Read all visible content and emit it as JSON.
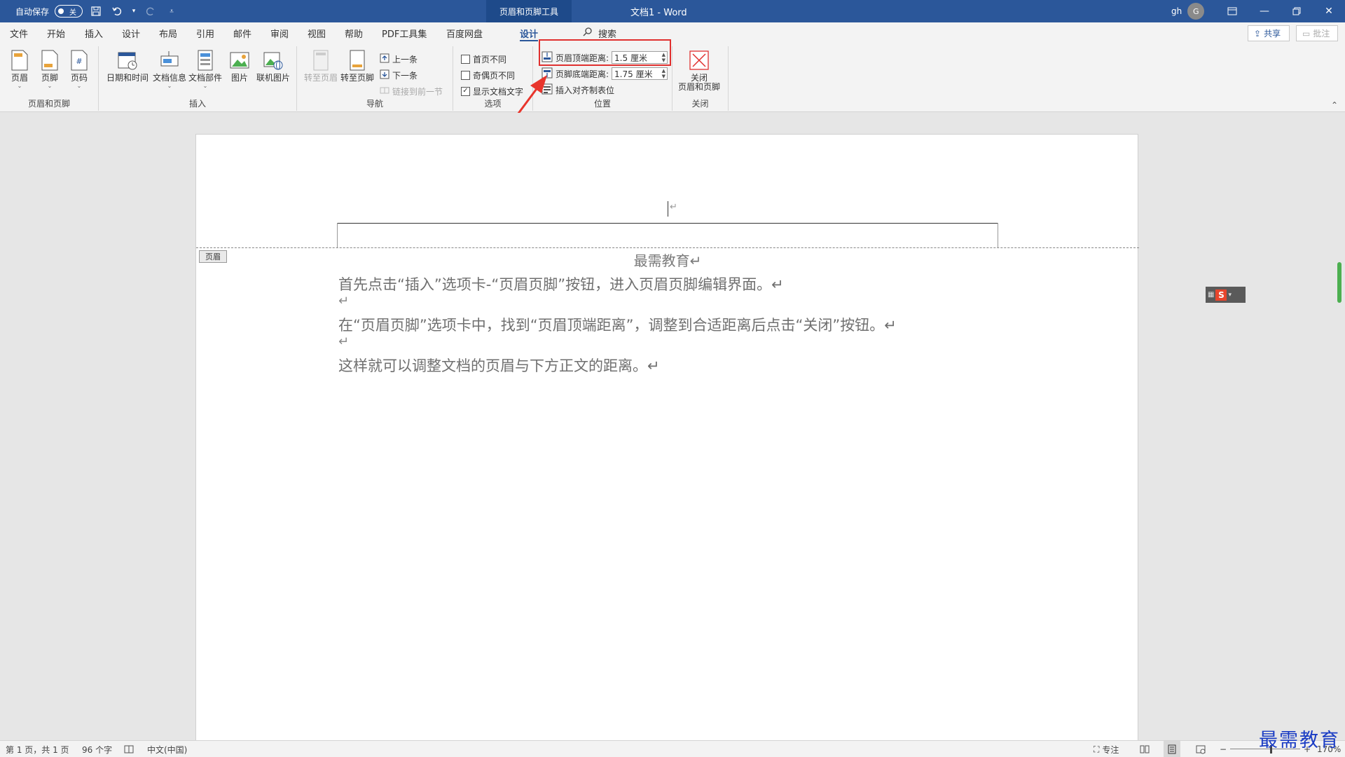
{
  "titlebar": {
    "autosave_label": "自动保存",
    "autosave_state": "关",
    "context_tab_title": "页眉和页脚工具",
    "doc_title": "文档1 - Word",
    "user_initials": "gh",
    "avatar_letter": "G",
    "accent_color": "#2b579a"
  },
  "tabs": [
    {
      "label": "文件",
      "active": false
    },
    {
      "label": "开始",
      "active": false
    },
    {
      "label": "插入",
      "active": false
    },
    {
      "label": "设计",
      "active": false
    },
    {
      "label": "布局",
      "active": false
    },
    {
      "label": "引用",
      "active": false
    },
    {
      "label": "邮件",
      "active": false
    },
    {
      "label": "审阅",
      "active": false
    },
    {
      "label": "视图",
      "active": false
    },
    {
      "label": "帮助",
      "active": false
    },
    {
      "label": "PDF工具集",
      "active": false
    },
    {
      "label": "百度网盘",
      "active": false
    },
    {
      "label": "设计",
      "active": true
    }
  ],
  "search_label": "搜索",
  "share_label": "共享",
  "comment_label": "批注",
  "ribbon": {
    "groups": {
      "header_footer": {
        "label": "页眉和页脚",
        "header": "页眉",
        "footer": "页脚",
        "page_number": "页码"
      },
      "insert": {
        "label": "插入",
        "date_time": "日期和时间",
        "doc_info": "文档信息",
        "doc_parts": "文档部件",
        "picture": "图片",
        "online_picture": "联机图片"
      },
      "navigation": {
        "label": "导航",
        "goto_header": "转至页眉",
        "goto_footer": "转至页脚",
        "previous": "上一条",
        "next": "下一条",
        "link_previous": "链接到前一节"
      },
      "options": {
        "label": "选项",
        "different_first": "首页不同",
        "different_odd_even": "奇偶页不同",
        "show_doc_text": "显示文档文字",
        "different_first_checked": false,
        "different_odd_even_checked": false,
        "show_doc_text_checked": true
      },
      "position": {
        "label": "位置",
        "header_top_label": "页眉顶端距离:",
        "header_top_value": "1.5 厘米",
        "footer_bottom_label": "页脚底端距离:",
        "footer_bottom_value": "1.75 厘米",
        "insert_align_tab": "插入对齐制表位"
      },
      "close": {
        "label": "关闭",
        "close_button_line1": "关闭",
        "close_button_line2": "页眉和页脚"
      }
    }
  },
  "document": {
    "header_tag": "页眉",
    "title": "最需教育↵",
    "paragraphs": [
      "首先点击“插入”选项卡-“页眉页脚”按钮，进入页眉页脚编辑界面。↵",
      "↵",
      "在“页眉页脚”选项卡中，找到“页眉顶端距离”，调整到合适距离后点击“关闭”按钮。↵",
      "↵",
      "这样就可以调整文档的页眉与下方正文的距离。↵"
    ]
  },
  "statusbar": {
    "page_info": "第 1 页，共 1 页",
    "word_count": "96 个字",
    "language": "中文(中国)",
    "focus": "专注",
    "zoom": "170%"
  },
  "ime_letter": "S",
  "watermark": "最需教育",
  "highlight_color": "#e0302f"
}
